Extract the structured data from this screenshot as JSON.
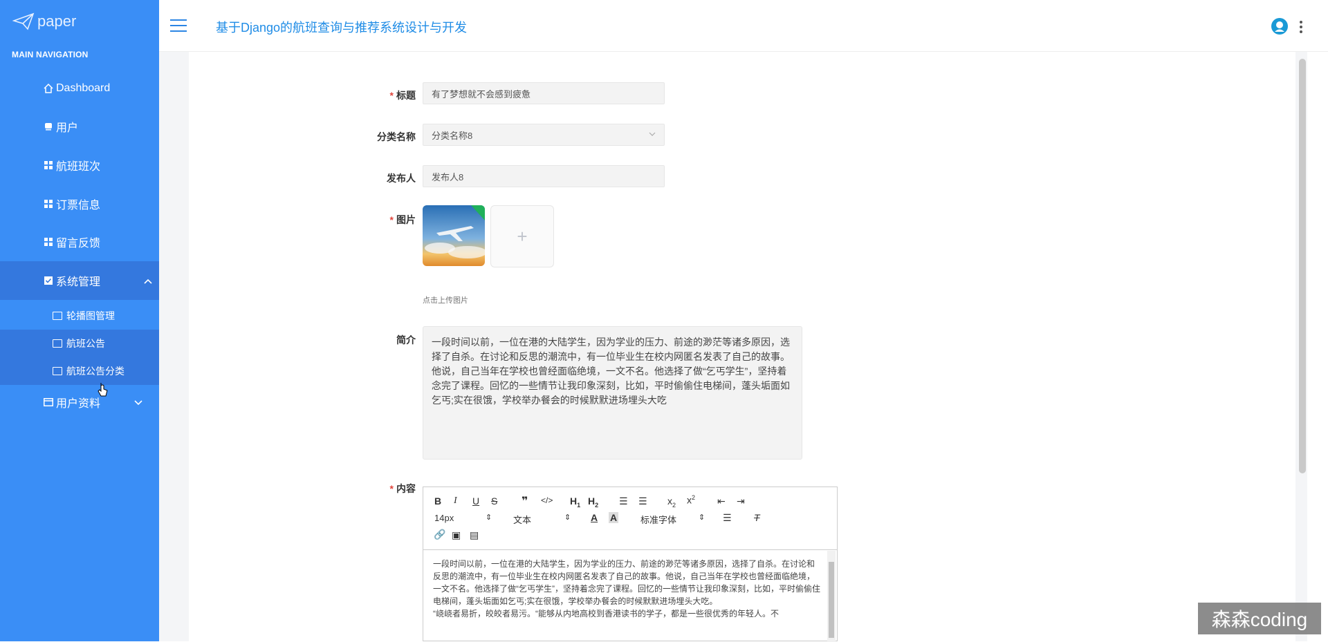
{
  "sidebar": {
    "logo_text": "paper",
    "section_title": "MAIN NAVIGATION",
    "items": [
      {
        "label": "Dashboard",
        "icon": "home-icon"
      },
      {
        "label": "用户",
        "icon": "user-icon"
      },
      {
        "label": "航班班次",
        "icon": "grid-icon"
      },
      {
        "label": "订票信息",
        "icon": "grid-icon"
      },
      {
        "label": "留言反馈",
        "icon": "grid-icon"
      },
      {
        "label": "系统管理",
        "icon": "check-square-icon"
      },
      {
        "label": "用户资料",
        "icon": "id-card-icon"
      }
    ],
    "sub_items": [
      {
        "label": "轮播图管理",
        "icon": "folder-icon"
      },
      {
        "label": "航班公告",
        "icon": "folder-icon"
      },
      {
        "label": "航班公告分类",
        "icon": "folder-icon"
      }
    ],
    "colors": {
      "bg": "#3a8ef6",
      "active": "#3478de"
    }
  },
  "header": {
    "title": "基于Django的航班查询与推荐系统设计与开发"
  },
  "form": {
    "title_label": "标题",
    "title_value": "有了梦想就不会感到疲惫",
    "category_label": "分类名称",
    "category_value": "分类名称8",
    "publisher_label": "发布人",
    "publisher_value": "发布人8",
    "image_label": "图片",
    "upload_hint": "点击上传图片",
    "summary_label": "简介",
    "summary_value": "一段时间以前，一位在港的大陆学生，因为学业的压力、前途的渺茫等诸多原因，选择了自杀。在讨论和反思的潮流中，有一位毕业生在校内网匿名发表了自己的故事。他说，自己当年在学校也曾经面临绝境，一文不名。他选择了做“乞丐学生”，坚持着念完了课程。回忆的一些情节让我印象深刻，比如，平时偷偷住电梯间，蓬头垢面如乞丐;实在很饿，学校举办餐会的时候默默进场埋头大吃",
    "content_label": "内容",
    "editor_toolbar": {
      "font_size": "14px",
      "paragraph": "文本",
      "font_family": "标准字体"
    },
    "content_value_p1": "一段时间以前，一位在港的大陆学生，因为学业的压力、前途的渺茫等诸多原因，选择了自杀。在讨论和反思的潮流中，有一位毕业生在校内网匿名发表了自己的故事。他说，自己当年在学校也曾经面临绝境，一文不名。他选择了做“乞丐学生”，坚持着念完了课程。回忆的一些情节让我印象深刻，比如，平时偷偷住电梯间，蓬头垢面如乞丐;实在很饿，学校举办餐会的时候默默进场埋头大吃。",
    "content_value_p2": "“峣峣者易折，皎皎者易污。“能够从内地高校到香港读书的学子，都是一些很优秀的年轻人。不"
  },
  "watermark": "森森coding"
}
